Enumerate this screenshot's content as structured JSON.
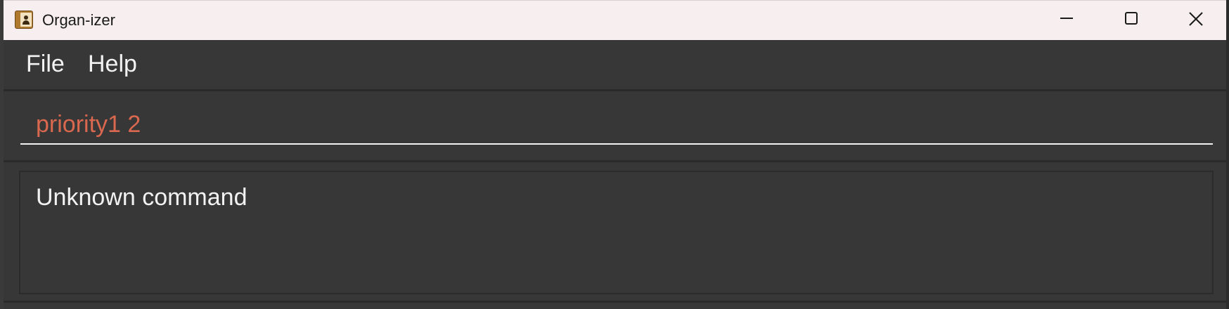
{
  "window": {
    "title": "Organ-izer",
    "icon": "address-book-icon",
    "controls": {
      "minimize": "minimize-icon",
      "maximize": "maximize-icon",
      "close": "close-icon"
    }
  },
  "menu": {
    "items": [
      {
        "label": "File"
      },
      {
        "label": "Help"
      }
    ]
  },
  "command": {
    "value": "priority1 2"
  },
  "result": {
    "message": "Unknown command"
  },
  "colors": {
    "command_text_error": "#d9684f",
    "background": "#373737",
    "titlebar": "#f7efef"
  }
}
